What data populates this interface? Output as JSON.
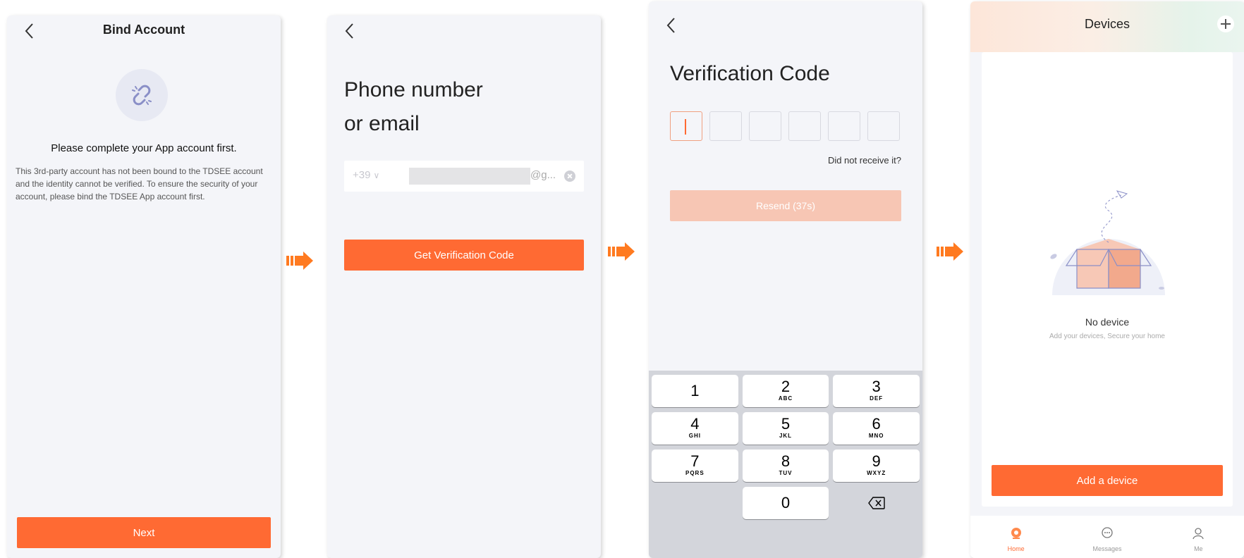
{
  "colors": {
    "accent": "#ff6a33",
    "accent_disabled": "#f7c6b4",
    "screen_bg": "#f4f5f9"
  },
  "screen1": {
    "title": "Bind Account",
    "heading": "Please complete your App account first.",
    "description": "This 3rd-party account has not been bound to the TDSEE account and the identity cannot be verified. To ensure the security of your account, please bind the TDSEE App account first.",
    "next_label": "Next",
    "icon": "unlink-icon"
  },
  "screen2": {
    "title_line1": "Phone number",
    "title_line2": "or email",
    "country_code": "+39",
    "email_suffix": "@g...",
    "button_label": "Get Verification Code"
  },
  "screen3": {
    "title": "Verification Code",
    "not_received": "Did not receive it?",
    "resend_label": "Resend (37s)",
    "keys": [
      [
        {
          "d": "1",
          "l": ""
        },
        {
          "d": "2",
          "l": "ABC"
        },
        {
          "d": "3",
          "l": "DEF"
        }
      ],
      [
        {
          "d": "4",
          "l": "GHI"
        },
        {
          "d": "5",
          "l": "JKL"
        },
        {
          "d": "6",
          "l": "MNO"
        }
      ],
      [
        {
          "d": "7",
          "l": "PQRS"
        },
        {
          "d": "8",
          "l": "TUV"
        },
        {
          "d": "9",
          "l": "WXYZ"
        }
      ],
      [
        {
          "d": "",
          "l": ""
        },
        {
          "d": "0",
          "l": ""
        },
        {
          "d": "",
          "l": ""
        }
      ]
    ]
  },
  "screen4": {
    "title": "Devices",
    "empty_title": "No device",
    "empty_subtitle": "Add your devices, Secure your home",
    "add_label": "Add a device",
    "tabs": [
      {
        "label": "Home",
        "icon": "camera-icon"
      },
      {
        "label": "Messages",
        "icon": "chat-bubble-icon"
      },
      {
        "label": "Me",
        "icon": "user-icon"
      }
    ]
  }
}
